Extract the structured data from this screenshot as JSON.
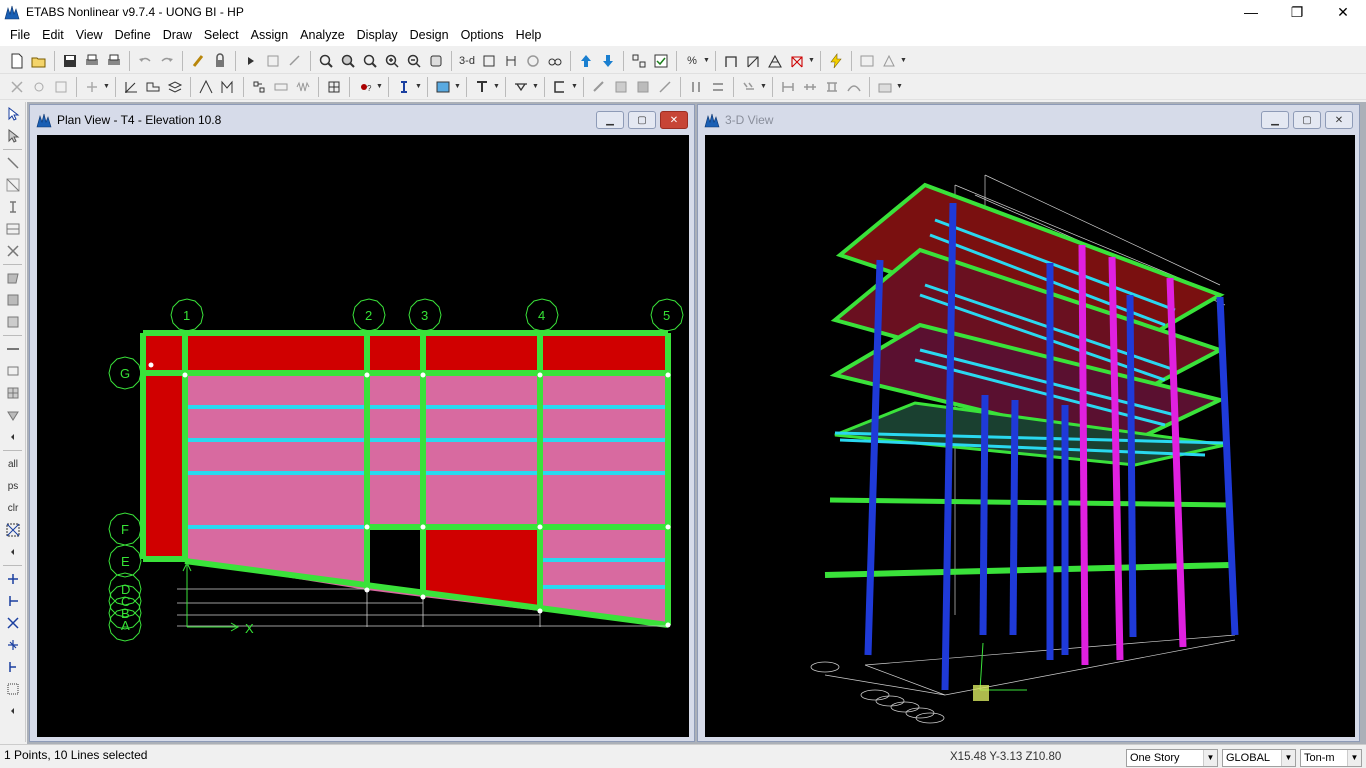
{
  "window": {
    "title": "ETABS Nonlinear v9.7.4 - UONG BI - HP",
    "minimize": "—",
    "maximize": "❐",
    "close": "✕"
  },
  "menu": [
    "File",
    "Edit",
    "View",
    "Define",
    "Draw",
    "Select",
    "Assign",
    "Analyze",
    "Display",
    "Design",
    "Options",
    "Help"
  ],
  "toolbar": {
    "view_3d_label": "3-d",
    "unit_toggle_label": "%"
  },
  "left_toolbar": {
    "select_all_label": "all",
    "previous_selection_label": "ps",
    "clear_selection_label": "clr"
  },
  "plan_window": {
    "title": "Plan View - T4 - Elevation 10.8",
    "grid_columns": [
      "1",
      "2",
      "3",
      "4",
      "5"
    ],
    "grid_rows": [
      "G",
      "F",
      "E",
      "D",
      "C",
      "B",
      "A"
    ],
    "axis_label": "X"
  },
  "view3d_window": {
    "title": "3-D View"
  },
  "status": {
    "selection_text": "1 Points, 10 Lines selected",
    "coordinates": "X15.48  Y-3.13  Z10.80",
    "story_select": "One Story",
    "coord_system_select": "GLOBAL",
    "units_select": "Ton-m"
  },
  "colors": {
    "frame_green": "#3ae23a",
    "slab_red": "#d00000",
    "slab_pink": "#d86aa0",
    "beam_cyan": "#2ad8f0",
    "column_blue": "#1f3ad8",
    "column_magenta": "#e020e0"
  }
}
